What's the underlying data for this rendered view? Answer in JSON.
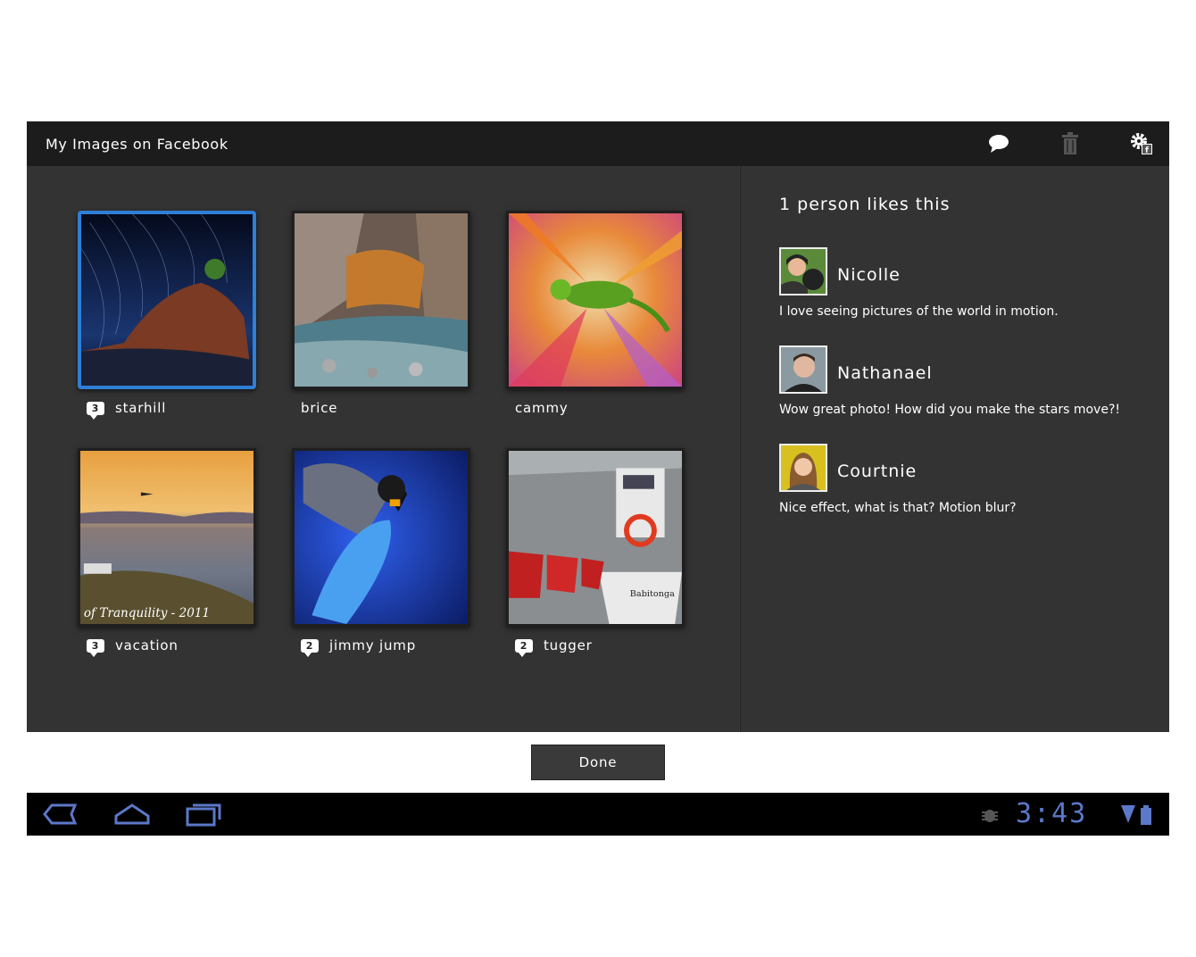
{
  "window": {
    "title": "My Images on Facebook"
  },
  "toolbar": {
    "icons": [
      "comment-icon",
      "trash-icon",
      "facebook-settings-icon"
    ]
  },
  "images": [
    {
      "name": "starhill",
      "comments": "3",
      "selected": true
    },
    {
      "name": "brice",
      "comments": ""
    },
    {
      "name": "cammy",
      "comments": ""
    },
    {
      "name": "vacation",
      "comments": "3",
      "watermark": "of Tranquility - 2011"
    },
    {
      "name": "jimmy jump",
      "comments": "2"
    },
    {
      "name": "tugger",
      "comments": "2",
      "boat_text": "Babitonga"
    }
  ],
  "panel": {
    "likes": "1 person likes this",
    "comments": [
      {
        "name": "Nicolle",
        "text": "I love seeing pictures of the world in motion."
      },
      {
        "name": "Nathanael",
        "text": "Wow great photo! How did you make the stars move?!"
      },
      {
        "name": "Courtnie",
        "text": "Nice effect, what is that? Motion blur?"
      }
    ]
  },
  "done_label": "Done",
  "system_bar": {
    "time": "3:43",
    "icons": [
      "back-icon",
      "home-icon",
      "recent-apps-icon",
      "debug-icon",
      "wifi-icon",
      "battery-icon"
    ]
  },
  "colors": {
    "selection": "#2f7fd6",
    "clock": "#5b78c9",
    "panel_bg": "#333333",
    "titlebar_bg": "#1c1c1c"
  }
}
